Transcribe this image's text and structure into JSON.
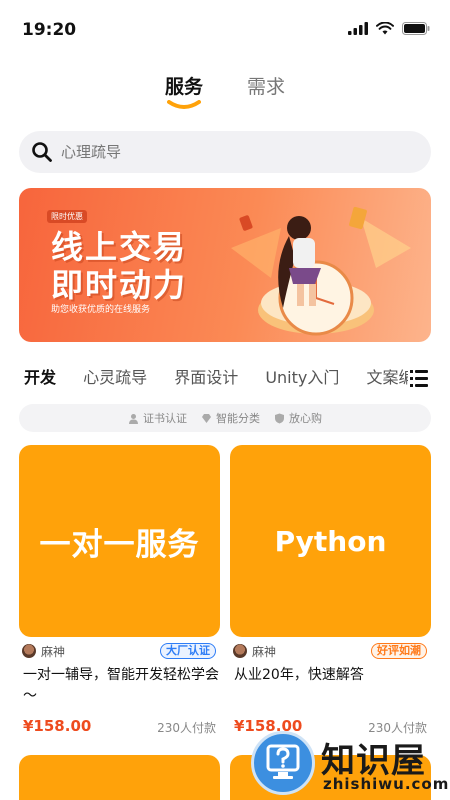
{
  "status_bar": {
    "time": "19:20"
  },
  "top_tabs": [
    {
      "label": "服务",
      "active": true
    },
    {
      "label": "需求",
      "active": false
    }
  ],
  "search": {
    "placeholder": "心理疏导"
  },
  "banner": {
    "tag": "限时优惠",
    "title_line1": "线上交易",
    "title_line2": "即时动力",
    "subtitle": "助您收获优质的在线服务"
  },
  "categories": [
    "开发",
    "心灵疏导",
    "界面设计",
    "Unity入门",
    "文案编"
  ],
  "features": [
    "证书认证",
    "智能分类",
    "放心购"
  ],
  "cards": [
    {
      "cover_text": "一对一服务",
      "seller": "麻神",
      "badge": "大厂认证",
      "badge_color": "#2e7df6",
      "desc": "一对一辅导，智能开发轻松学会～",
      "price": "¥158.00",
      "sold": "230人付款"
    },
    {
      "cover_text": "Python",
      "seller": "麻神",
      "badge": "好评如潮",
      "badge_color": "#ff7a1a",
      "desc": "从业20年，快速解答",
      "price": "¥158.00",
      "sold": "230人付款"
    }
  ],
  "watermark": {
    "title": "知识屋",
    "url": "zhishiwu.com"
  },
  "colors": {
    "accent_orange": "#ffa20a",
    "price_red": "#ee4b1e",
    "banner": "#f7653c"
  }
}
